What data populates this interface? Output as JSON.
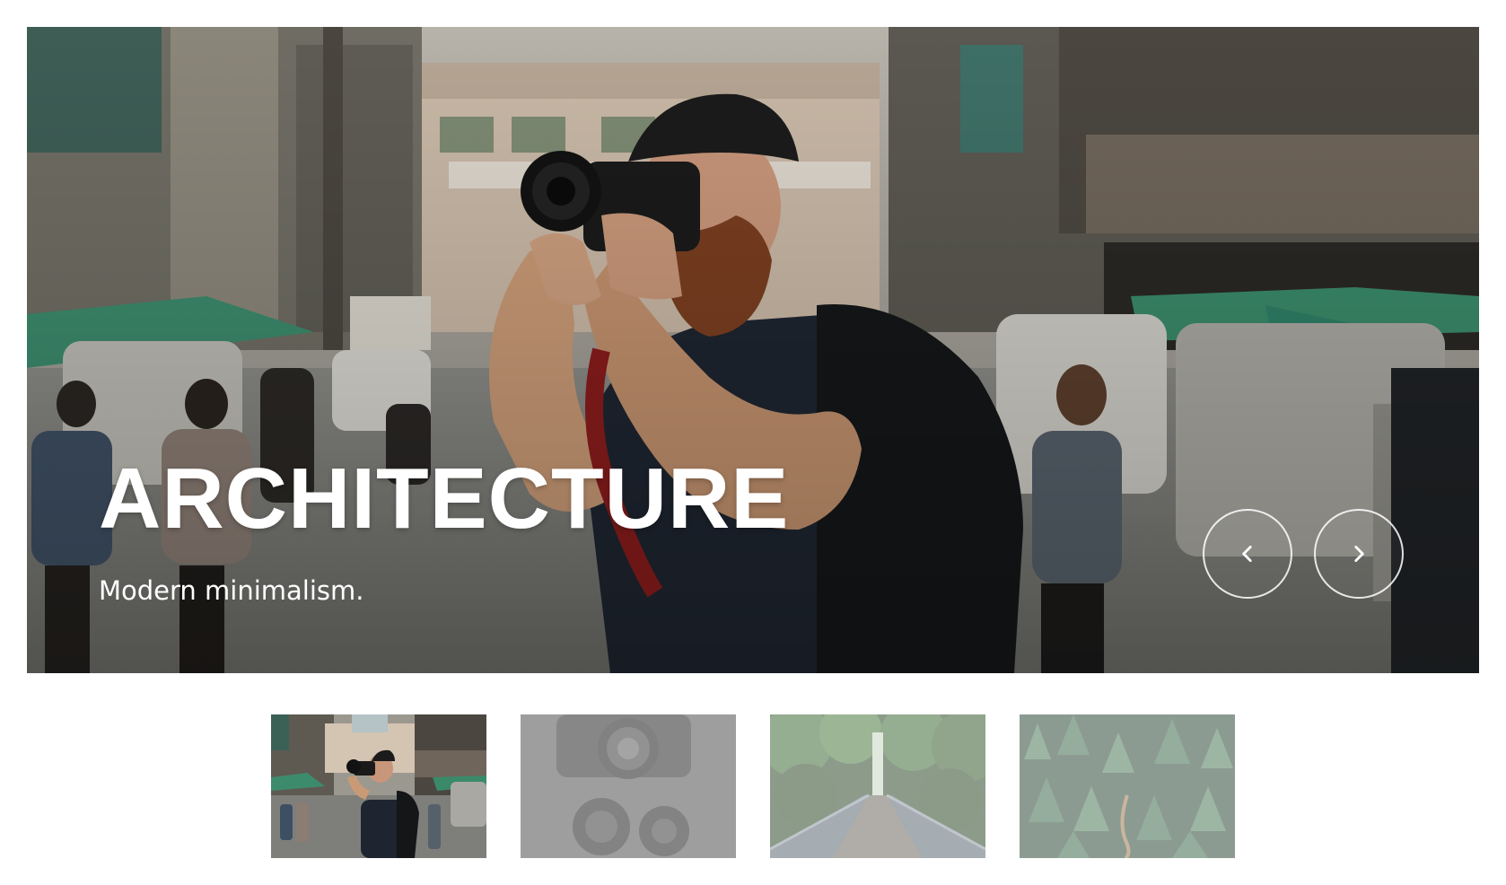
{
  "slider": {
    "title": "ARCHITECTURE",
    "subtitle": "Modern minimalism.",
    "active_index": 0,
    "prev_icon": "chevron-left-icon",
    "next_icon": "chevron-right-icon"
  },
  "thumbnails": [
    {
      "subject": "photographer-street",
      "active": true
    },
    {
      "subject": "camera-lenses",
      "active": false
    },
    {
      "subject": "forest-bridge",
      "active": false
    },
    {
      "subject": "pine-forest-aerial",
      "active": false
    }
  ],
  "colors": {
    "text": "#ffffff",
    "background": "#ffffff",
    "nav_border": "#ffffff"
  }
}
